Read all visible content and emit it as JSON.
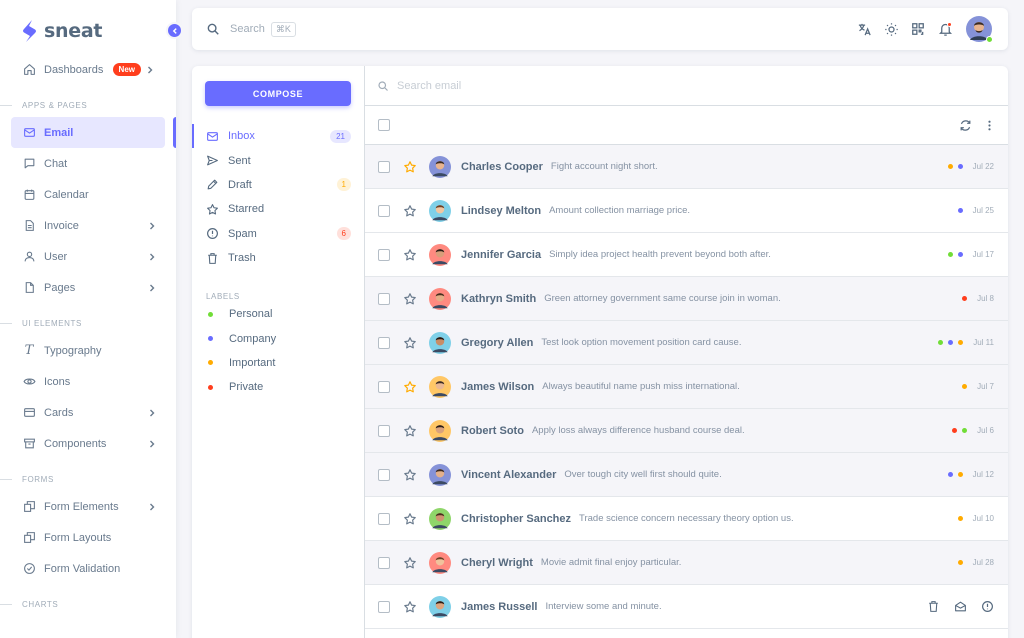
{
  "brand": {
    "name": "sneat"
  },
  "colors": {
    "primary": "#696cff",
    "personal": "#71dd37",
    "company": "#696cff",
    "important": "#ffab00",
    "private": "#ff3e1d",
    "star_active": "#ffab00"
  },
  "sidebar": {
    "dashboards": {
      "label": "Dashboards",
      "badge": "New"
    },
    "headers": {
      "apps": "APPS & PAGES",
      "ui": "UI ELEMENTS",
      "forms": "FORMS",
      "charts": "CHARTS"
    },
    "apps": [
      {
        "label": "Email",
        "icon": "mail-icon"
      },
      {
        "label": "Chat",
        "icon": "chat-icon"
      },
      {
        "label": "Calendar",
        "icon": "calendar-icon"
      },
      {
        "label": "Invoice",
        "icon": "invoice-icon"
      },
      {
        "label": "User",
        "icon": "user-icon"
      },
      {
        "label": "Pages",
        "icon": "pages-icon"
      }
    ],
    "ui": [
      {
        "label": "Typography",
        "icon": "typography-icon"
      },
      {
        "label": "Icons",
        "icon": "eye-icon"
      },
      {
        "label": "Cards",
        "icon": "card-icon"
      },
      {
        "label": "Components",
        "icon": "archive-icon"
      }
    ],
    "forms": [
      {
        "label": "Form Elements",
        "icon": "form-elements-icon"
      },
      {
        "label": "Form Layouts",
        "icon": "form-layouts-icon"
      },
      {
        "label": "Form Validation",
        "icon": "check-circle-icon"
      }
    ]
  },
  "navbar": {
    "search_placeholder": "Search",
    "search_shortcut": "⌘K"
  },
  "email_side": {
    "compose_label": "COMPOSE",
    "folders": [
      {
        "label": "Inbox",
        "count": "21"
      },
      {
        "label": "Sent",
        "count": ""
      },
      {
        "label": "Draft",
        "count": "1"
      },
      {
        "label": "Starred",
        "count": ""
      },
      {
        "label": "Spam",
        "count": "6"
      },
      {
        "label": "Trash",
        "count": ""
      }
    ],
    "labels_header": "LABELS",
    "labels": [
      {
        "label": "Personal"
      },
      {
        "label": "Company"
      },
      {
        "label": "Important"
      },
      {
        "label": "Private"
      }
    ]
  },
  "email_list": {
    "search_placeholder": "Search email",
    "emails": [
      {
        "name": "Charles Cooper",
        "snippet": "Fight account night short.",
        "date": "Jul 22",
        "starred": true,
        "read": true,
        "tags": [
          "important",
          "company"
        ]
      },
      {
        "name": "Lindsey Melton",
        "snippet": "Amount collection marriage price.",
        "date": "Jul 25",
        "starred": false,
        "read": false,
        "tags": [
          "company"
        ]
      },
      {
        "name": "Jennifer Garcia",
        "snippet": "Simply idea project health prevent beyond both after.",
        "date": "Jul 17",
        "starred": false,
        "read": false,
        "tags": [
          "personal",
          "company"
        ]
      },
      {
        "name": "Kathryn Smith",
        "snippet": "Green attorney government same course join in woman.",
        "date": "Jul 8",
        "starred": false,
        "read": true,
        "tags": [
          "private"
        ]
      },
      {
        "name": "Gregory Allen",
        "snippet": "Test look option movement position card cause.",
        "date": "Jul 11",
        "starred": false,
        "read": true,
        "tags": [
          "personal",
          "company",
          "important"
        ]
      },
      {
        "name": "James Wilson",
        "snippet": "Always beautiful name push miss international.",
        "date": "Jul 7",
        "starred": true,
        "read": true,
        "tags": [
          "important"
        ]
      },
      {
        "name": "Robert Soto",
        "snippet": "Apply loss always difference husband course deal.",
        "date": "Jul 6",
        "starred": false,
        "read": true,
        "tags": [
          "private",
          "personal"
        ]
      },
      {
        "name": "Vincent Alexander",
        "snippet": "Over tough city well first should quite.",
        "date": "Jul 12",
        "starred": false,
        "read": true,
        "tags": [
          "company",
          "important"
        ]
      },
      {
        "name": "Christopher Sanchez",
        "snippet": "Trade science concern necessary theory option us.",
        "date": "Jul 10",
        "starred": false,
        "read": false,
        "tags": [
          "important"
        ]
      },
      {
        "name": "Cheryl Wright",
        "snippet": "Movie admit final enjoy particular.",
        "date": "Jul 28",
        "starred": false,
        "read": true,
        "tags": [
          "important"
        ]
      },
      {
        "name": "James Russell",
        "snippet": "Interview some and minute.",
        "date": "",
        "starred": false,
        "read": false,
        "tags": [],
        "hover": true
      }
    ]
  }
}
